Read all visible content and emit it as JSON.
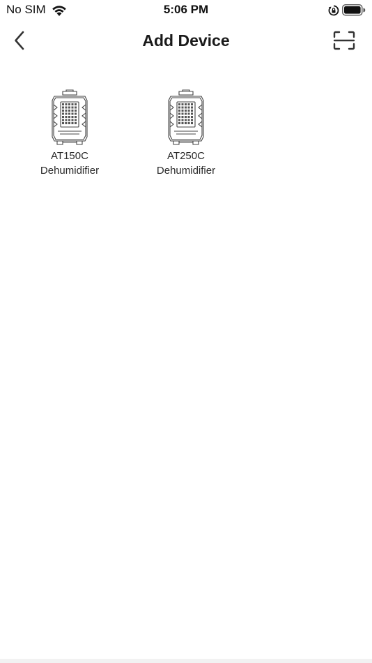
{
  "status_bar": {
    "carrier": "No SIM",
    "time": "5:06 PM",
    "icons": [
      "wifi-icon",
      "orientation-lock-icon",
      "battery-icon"
    ]
  },
  "nav": {
    "title": "Add Device",
    "back_icon": "chevron-left-icon",
    "scan_icon": "scan-icon"
  },
  "devices": [
    {
      "model": "AT150C",
      "type": "Dehumidifier"
    },
    {
      "model": "AT250C",
      "type": "Dehumidifier"
    }
  ],
  "colors": {
    "background": "#ffffff",
    "text": "#1a1a1a",
    "icon": "#333333"
  }
}
